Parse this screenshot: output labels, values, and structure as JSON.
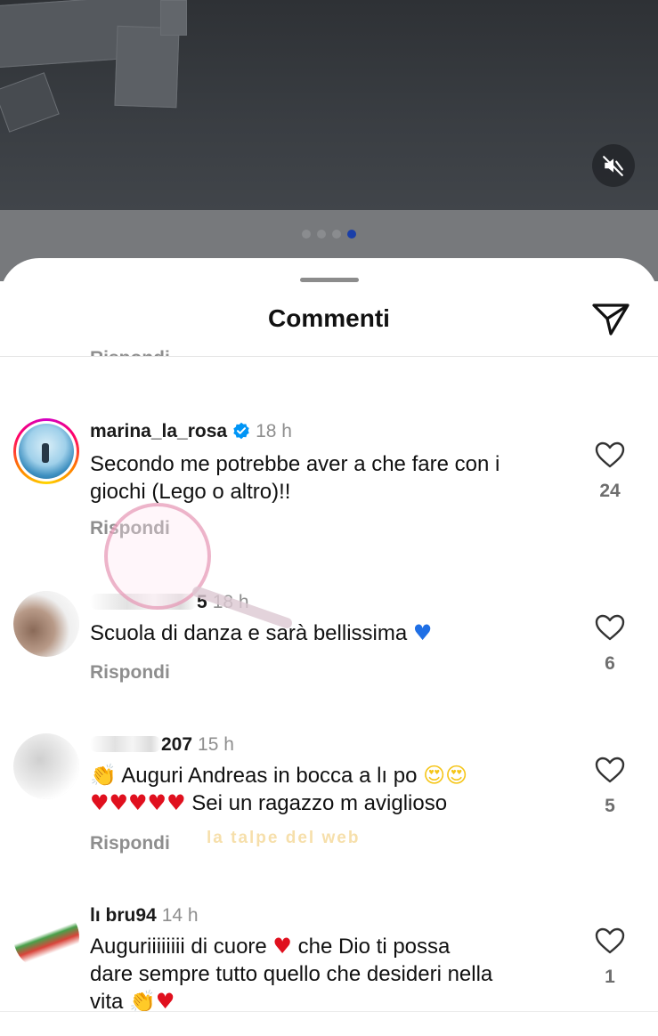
{
  "carousel": {
    "total": 4,
    "active_index": 3
  },
  "sheet": {
    "title": "Commenti"
  },
  "partial_reply_label": "Rispondi",
  "comments": [
    {
      "username": "marina_la_rosa",
      "verified": true,
      "time": "18 h",
      "text_line1": "Secondo me potrebbe aver a che fare con i",
      "text_line2": "giochi (Lego o altro)!!",
      "reply_label": "Rispondi",
      "likes": "24"
    },
    {
      "username_visible": "5",
      "time": "18 h",
      "text": "Scuola di danza e sarà bellissima",
      "reply_label": "Rispondi",
      "likes": "6"
    },
    {
      "username_visible": "207",
      "time": "15 h",
      "text_line1": "Auguri Andreas in bocca a  lı po",
      "text_line2": "Sei un ragazzo m  aviglioso",
      "reply_label": "Rispondi",
      "likes": "5"
    },
    {
      "username": "lı bru94",
      "time": "14 h",
      "text_line1a": "Auguriiiiiiii di cuore",
      "text_line1b": "che Dio ti possa",
      "text_line2": "dare sempre tutto quello che desideri nella",
      "text_line3": "vita",
      "likes": "1"
    }
  ],
  "watermark": {
    "text": "la talpe del web"
  },
  "icons": {
    "mute": "speaker-muted-icon",
    "share": "paper-plane-icon",
    "like": "heart-outline-icon",
    "verified": "verified-badge-icon"
  },
  "colors": {
    "accent_blue": "#1a3fa8",
    "verified": "#0095f6",
    "meta_grey": "#8e8e8e"
  }
}
